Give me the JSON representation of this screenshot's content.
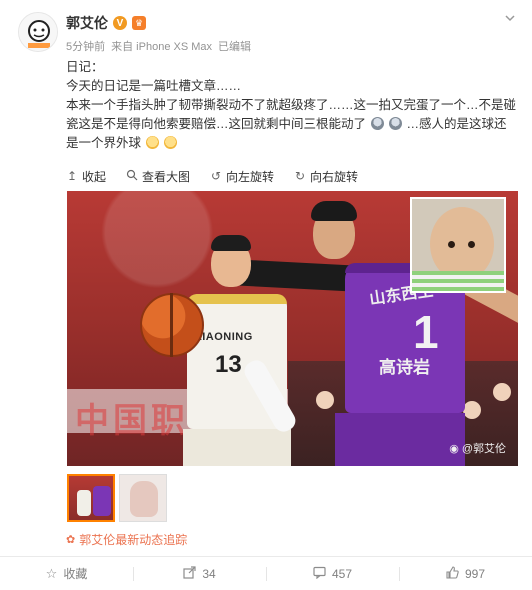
{
  "header": {
    "username": "郭艾伦",
    "verified_badge": "V",
    "member_badge": "♛",
    "time": "5分钟前",
    "source": "来自 iPhone XS Max",
    "edited": "已编辑"
  },
  "post": {
    "line1": "日记：",
    "line2": "今天的日记是一篇吐槽文章……",
    "line3": "本来一个手指头肿了韧带撕裂动不了就超级疼了……这一拍又完蛋了一个…不是碰瓷这是不是得向他索要赔偿…这回就剩中间三根能动了",
    "line3_tail": "…感人的是这球还是一个界外球"
  },
  "media_toolbar": {
    "collapse": "收起",
    "view_large": "查看大图",
    "rotate_left": "向左旋转",
    "rotate_right": "向右旋转"
  },
  "photo": {
    "white_team": "LIAONING",
    "white_number": "13",
    "purple_team": "山东西王",
    "purple_number": "1",
    "purple_name": "高诗岩",
    "banner": "中国职",
    "watermark": "@郭艾伦"
  },
  "trace_link": "郭艾伦最新动态追踪",
  "footer": {
    "favorite": "收藏",
    "repost": "34",
    "comment": "457",
    "like": "997"
  },
  "colors": {
    "accent": "#ff8200",
    "trace": "#eb7350",
    "purple_jersey": "#7b36b5"
  },
  "icons": [
    "more-icon",
    "collapse-icon",
    "search-icon",
    "rotate-left-icon",
    "rotate-right-icon",
    "star-icon",
    "repost-icon",
    "comment-icon",
    "like-icon",
    "weibo-icon"
  ]
}
